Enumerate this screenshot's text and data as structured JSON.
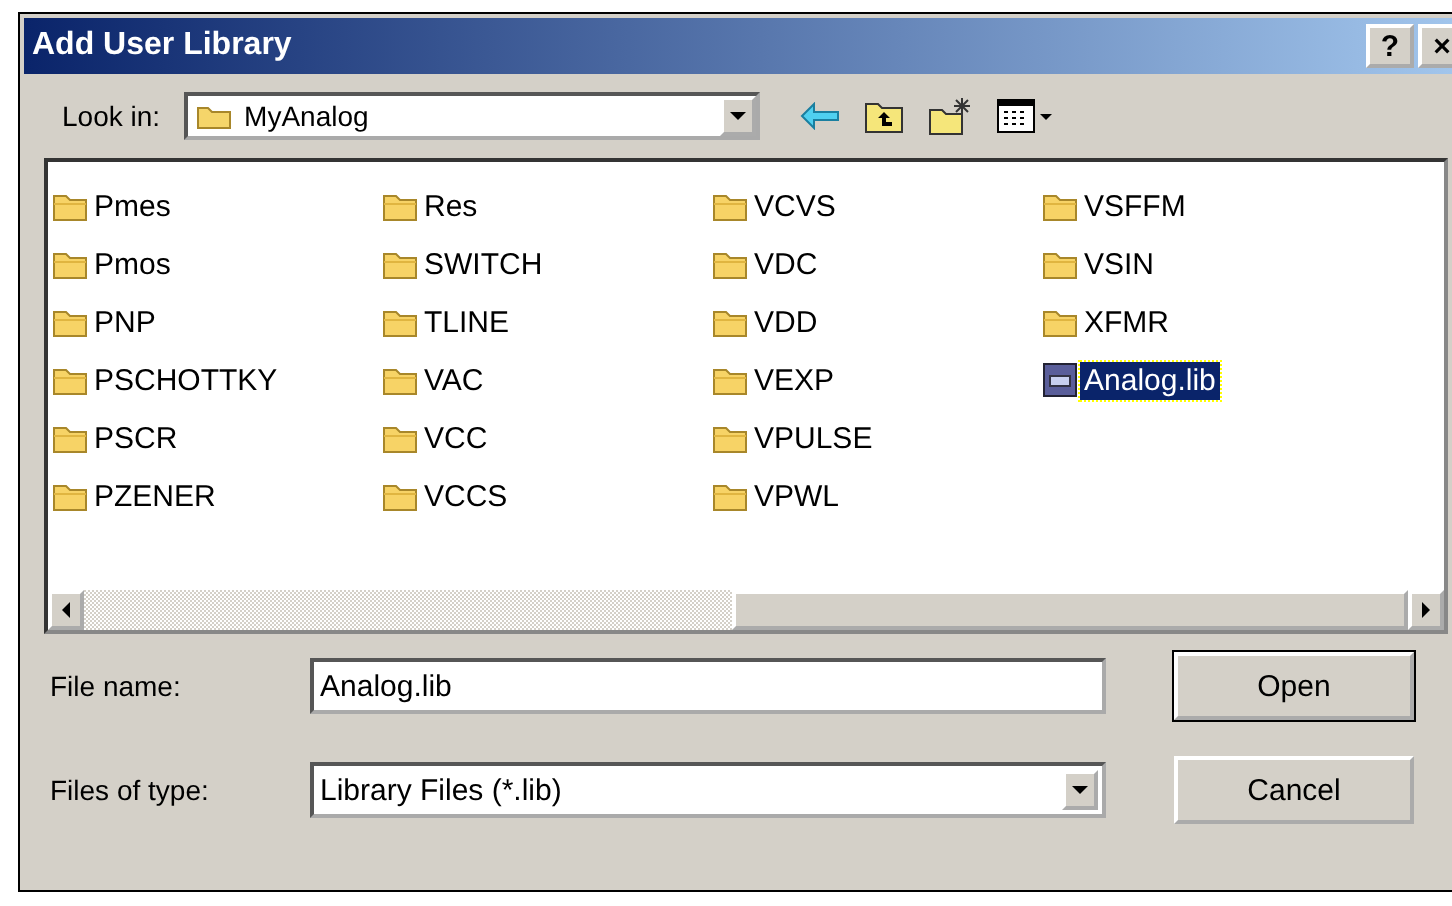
{
  "window": {
    "title": "Add User Library",
    "help": "?",
    "close": "×"
  },
  "look_in": {
    "label": "Look in:",
    "value": "MyAnalog"
  },
  "items": [
    {
      "name": "Pmes",
      "kind": "folder",
      "selected": false
    },
    {
      "name": "Pmos",
      "kind": "folder",
      "selected": false
    },
    {
      "name": "PNP",
      "kind": "folder",
      "selected": false
    },
    {
      "name": "PSCHOTTKY",
      "kind": "folder",
      "selected": false
    },
    {
      "name": "PSCR",
      "kind": "folder",
      "selected": false
    },
    {
      "name": "PZENER",
      "kind": "folder",
      "selected": false
    },
    {
      "name": "Res",
      "kind": "folder",
      "selected": false
    },
    {
      "name": "SWITCH",
      "kind": "folder",
      "selected": false
    },
    {
      "name": "TLINE",
      "kind": "folder",
      "selected": false
    },
    {
      "name": "VAC",
      "kind": "folder",
      "selected": false
    },
    {
      "name": "VCC",
      "kind": "folder",
      "selected": false
    },
    {
      "name": "VCCS",
      "kind": "folder",
      "selected": false
    },
    {
      "name": "VCVS",
      "kind": "folder",
      "selected": false
    },
    {
      "name": "VDC",
      "kind": "folder",
      "selected": false
    },
    {
      "name": "VDD",
      "kind": "folder",
      "selected": false
    },
    {
      "name": "VEXP",
      "kind": "folder",
      "selected": false
    },
    {
      "name": "VPULSE",
      "kind": "folder",
      "selected": false
    },
    {
      "name": "VPWL",
      "kind": "folder",
      "selected": false
    },
    {
      "name": "VSFFM",
      "kind": "folder",
      "selected": false
    },
    {
      "name": "VSIN",
      "kind": "folder",
      "selected": false
    },
    {
      "name": "XFMR",
      "kind": "folder",
      "selected": false
    },
    {
      "name": "Analog.lib",
      "kind": "file",
      "selected": true
    }
  ],
  "file_name": {
    "label": "File name:",
    "value": "Analog.lib"
  },
  "file_type": {
    "label": "Files of type:",
    "value": "Library Files (*.lib)"
  },
  "buttons": [
    {
      "label": "Open",
      "default": true
    },
    {
      "label": "Cancel",
      "default": false
    }
  ]
}
